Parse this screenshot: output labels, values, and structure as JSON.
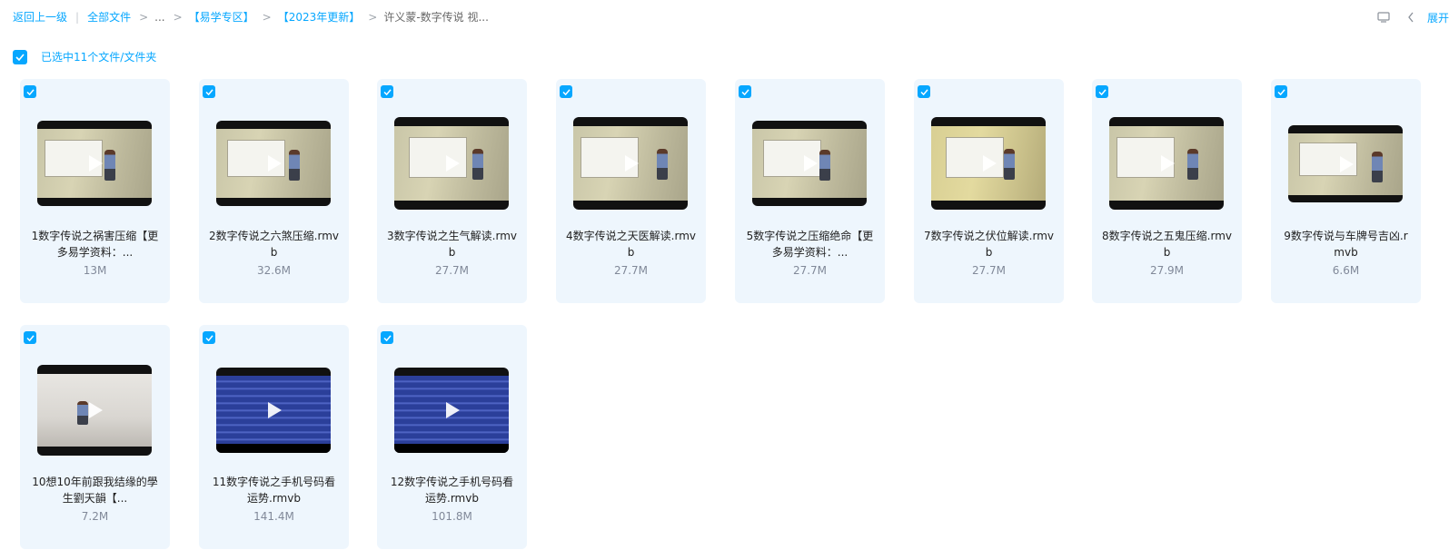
{
  "breadcrumb": {
    "back": "返回上一级",
    "separator": "|",
    "items": [
      "全部文件",
      "...",
      "【易学专区】",
      "【2023年更新】"
    ],
    "current": "许义蒙-数字传说 视..."
  },
  "topbar": {
    "expand_label": "展开"
  },
  "selection": {
    "label": "已选中11个文件/文件夹"
  },
  "files": [
    {
      "name": "1数字传说之祸害压缩【更多易学资料：...",
      "size": "13M",
      "thumb": "classroom"
    },
    {
      "name": "2数字传说之六煞压缩.rmvb",
      "size": "32.6M",
      "thumb": "classroom"
    },
    {
      "name": "3数字传说之生气解读.rmvb",
      "size": "27.7M",
      "thumb": "classroom"
    },
    {
      "name": "4数字传说之天医解读.rmvb",
      "size": "27.7M",
      "thumb": "classroom"
    },
    {
      "name": "5数字传说之压缩绝命【更多易学资料：...",
      "size": "27.7M",
      "thumb": "classroom"
    },
    {
      "name": "7数字传说之伏位解读.rmvb",
      "size": "27.7M",
      "thumb": "classroom-yellow"
    },
    {
      "name": "8数字传说之五鬼压缩.rmvb",
      "size": "27.9M",
      "thumb": "classroom"
    },
    {
      "name": "9数字传说与车牌号吉凶.rmvb",
      "size": "6.6M",
      "thumb": "classroom"
    },
    {
      "name": "10想10年前跟我结缘的學生劉天韻【...",
      "size": "7.2M",
      "thumb": "room"
    },
    {
      "name": "11数字传说之手机号码看运势.rmvb",
      "size": "141.4M",
      "thumb": "text"
    },
    {
      "name": "12数字传说之手机号码看运势.rmvb",
      "size": "101.8M",
      "thumb": "text"
    }
  ],
  "colors": {
    "accent": "#06a7ff",
    "card_bg": "#eef6fd",
    "size_text": "#818999"
  }
}
